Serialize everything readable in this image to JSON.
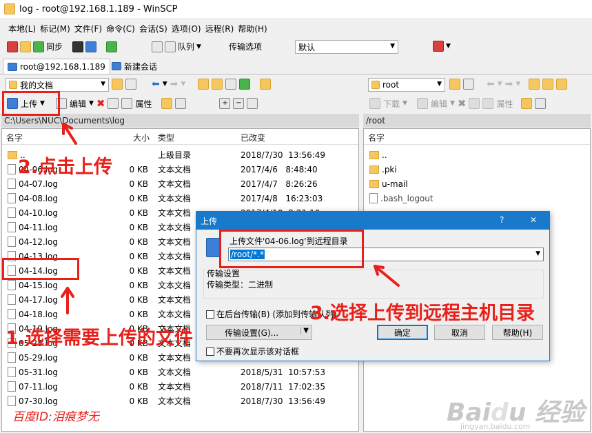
{
  "window": {
    "title": "log - root@192.168.1.189 - WinSCP"
  },
  "menu": [
    "本地(L)",
    "标记(M)",
    "文件(F)",
    "命令(C)",
    "会话(S)",
    "选项(O)",
    "远程(R)",
    "帮助(H)"
  ],
  "toolbar": {
    "sync_label": "同步",
    "queue_label": "队列",
    "transfer_options_label": "传输选项",
    "transfer_options_value": "默认"
  },
  "tabs": {
    "session": "root@192.168.1.189",
    "new_session": "新建会话"
  },
  "local": {
    "location": "我的文档",
    "upload_label": "上传",
    "edit_label": "编辑",
    "props_label": "属性",
    "path": "C:\\Users\\NUC\\Documents\\log",
    "columns": {
      "name": "名字",
      "size": "大小",
      "type": "类型",
      "modified": "已改变"
    },
    "rows": [
      {
        "name": "..",
        "size": "",
        "type": "上级目录",
        "modified": "2018/7/30  13:56:49"
      },
      {
        "name": "04-06.log",
        "size": "0 KB",
        "type": "文本文档",
        "modified": "2017/4/6   8:48:40"
      },
      {
        "name": "04-07.log",
        "size": "0 KB",
        "type": "文本文档",
        "modified": "2017/4/7   8:26:26"
      },
      {
        "name": "04-08.log",
        "size": "0 KB",
        "type": "文本文档",
        "modified": "2017/4/8   16:23:03"
      },
      {
        "name": "04-10.log",
        "size": "0 KB",
        "type": "文本文档",
        "modified": "2017/4/10  8:21:10"
      },
      {
        "name": "04-11.log",
        "size": "0 KB",
        "type": "文本文档",
        "modified": ""
      },
      {
        "name": "04-12.log",
        "size": "0 KB",
        "type": "文本文档",
        "modified": ""
      },
      {
        "name": "04-13.log",
        "size": "0 KB",
        "type": "文本文档",
        "modified": ""
      },
      {
        "name": "04-14.log",
        "size": "0 KB",
        "type": "文本文档",
        "modified": ""
      },
      {
        "name": "04-15.log",
        "size": "0 KB",
        "type": "文本文档",
        "modified": ""
      },
      {
        "name": "04-17.log",
        "size": "0 KB",
        "type": "文本文档",
        "modified": ""
      },
      {
        "name": "04-18.log",
        "size": "0 KB",
        "type": "文本文档",
        "modified": ""
      },
      {
        "name": "04-19.log",
        "size": "0 KB",
        "type": "文本文档",
        "modified": ""
      },
      {
        "name": "05-28.log",
        "size": "0 KB",
        "type": "文本文档",
        "modified": ""
      },
      {
        "name": "05-29.log",
        "size": "0 KB",
        "type": "文本文档",
        "modified": ""
      },
      {
        "name": "05-31.log",
        "size": "0 KB",
        "type": "文本文档",
        "modified": "2018/5/31  10:57:53"
      },
      {
        "name": "07-11.log",
        "size": "0 KB",
        "type": "文本文档",
        "modified": "2018/7/11  17:02:35"
      },
      {
        "name": "07-30.log",
        "size": "0 KB",
        "type": "文本文档",
        "modified": "2018/7/30  13:56:49"
      }
    ]
  },
  "remote": {
    "location": "root",
    "download_label": "下载",
    "edit_label": "编辑",
    "props_label": "属性",
    "path": "/root",
    "columns": {
      "name": "名字"
    },
    "rows": [
      {
        "name": "..",
        "kind": "up"
      },
      {
        "name": ".pki",
        "kind": "folder"
      },
      {
        "name": "u-mail",
        "kind": "folder"
      },
      {
        "name": ".bash_logout",
        "kind": "file"
      }
    ]
  },
  "dialog": {
    "title": "上传",
    "help_q": "?",
    "close": "✕",
    "prompt": "上传文件'04-06.log'到远程目录",
    "target": "/root/*.*",
    "transfer_section": "传输设置",
    "transfer_type": "传输类型：二进制",
    "background_label": "在后台传输(B) (添加到传输队列)",
    "settings_button": "传输设置(G)...",
    "ok": "确定",
    "cancel": "取消",
    "help": "帮助(H)",
    "dont_show": "不要再次显示该对话框"
  },
  "annotations": {
    "step1": "1.选择需要上传的文件",
    "step2": "2.点击上传",
    "step3": "3.选择上传到远程主机目录",
    "signature": "百度ID:泪痕梦无",
    "watermark_url": "jingyan.baidu.com"
  },
  "colors": {
    "accent": "#1979ca",
    "annotation": "#e8201a"
  }
}
